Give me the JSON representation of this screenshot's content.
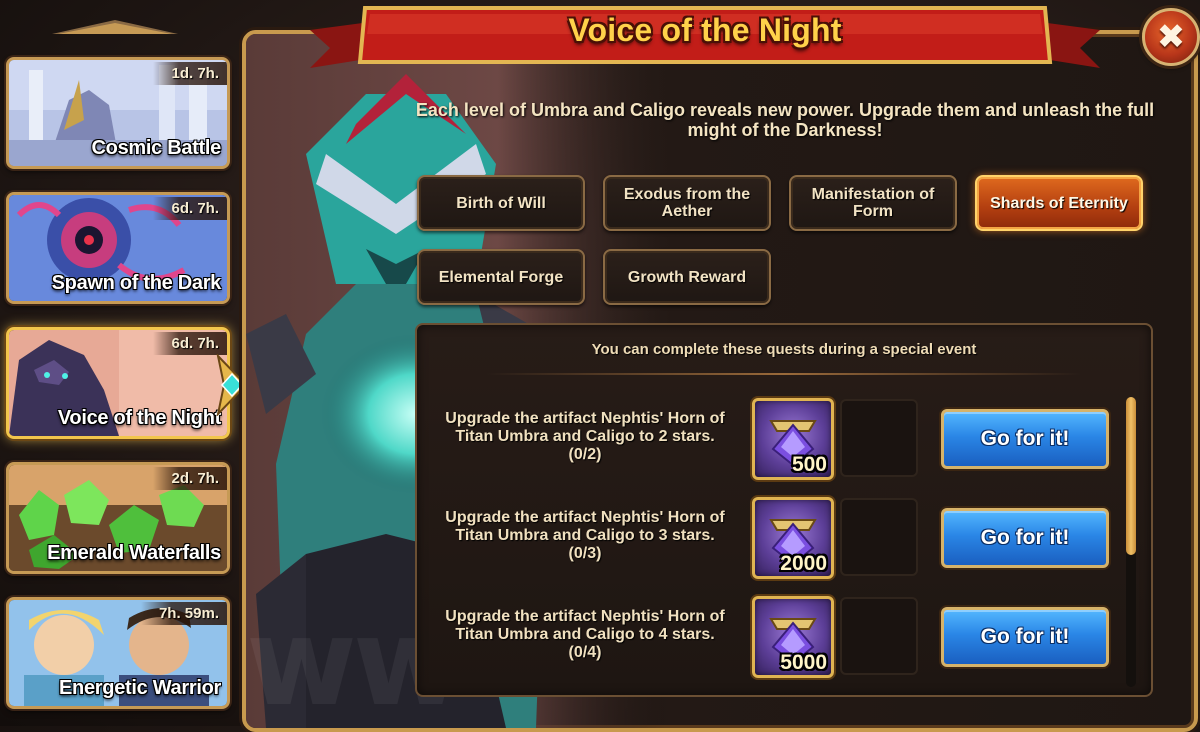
{
  "events": [
    {
      "title": "Cosmic Battle",
      "timer": "1d. 7h."
    },
    {
      "title": "Spawn of the Dark",
      "timer": "6d. 7h."
    },
    {
      "title": "Voice of the Night",
      "timer": "6d. 7h."
    },
    {
      "title": "Emerald Waterfalls",
      "timer": "2d. 7h."
    },
    {
      "title": "Energetic Warrior",
      "timer": "7h. 59m."
    }
  ],
  "header": {
    "title": "Voice of the Night"
  },
  "description": "Each level of Umbra and Caligo reveals new power. Upgrade them and unleash the full might of the Darkness!",
  "tabs": [
    {
      "label": "Birth of Will"
    },
    {
      "label": "Exodus from the Aether"
    },
    {
      "label": "Manifestation of Form"
    },
    {
      "label": "Shards of Eternity"
    },
    {
      "label": "Elemental Forge"
    },
    {
      "label": "Growth Reward"
    }
  ],
  "active_tab": "Shards of Eternity",
  "quests_header": "You can complete these quests during a special event",
  "quests": [
    {
      "line1": "Upgrade the artifact Nephtis' Horn of",
      "line2": "Titan Umbra and Caligo to 2 stars.",
      "progress": "(0/2)",
      "reward": "500",
      "button": "Go for it!"
    },
    {
      "line1": "Upgrade the artifact Nephtis' Horn of",
      "line2": "Titan Umbra and Caligo to 3 stars.",
      "progress": "(0/3)",
      "reward": "2000",
      "button": "Go for it!"
    },
    {
      "line1": "Upgrade the artifact Nephtis' Horn of",
      "line2": "Titan Umbra and Caligo to 4 stars.",
      "progress": "(0/4)",
      "reward": "5000",
      "button": "Go for it!"
    }
  ],
  "colors": {
    "title_gold": "#ffd24a",
    "active_tab": "#d0541a",
    "go_button": "#2a86e6",
    "panel_border": "#c89a4e"
  },
  "icons": {
    "close": "close-icon",
    "reward": "titan-artifact-essence-icon"
  }
}
